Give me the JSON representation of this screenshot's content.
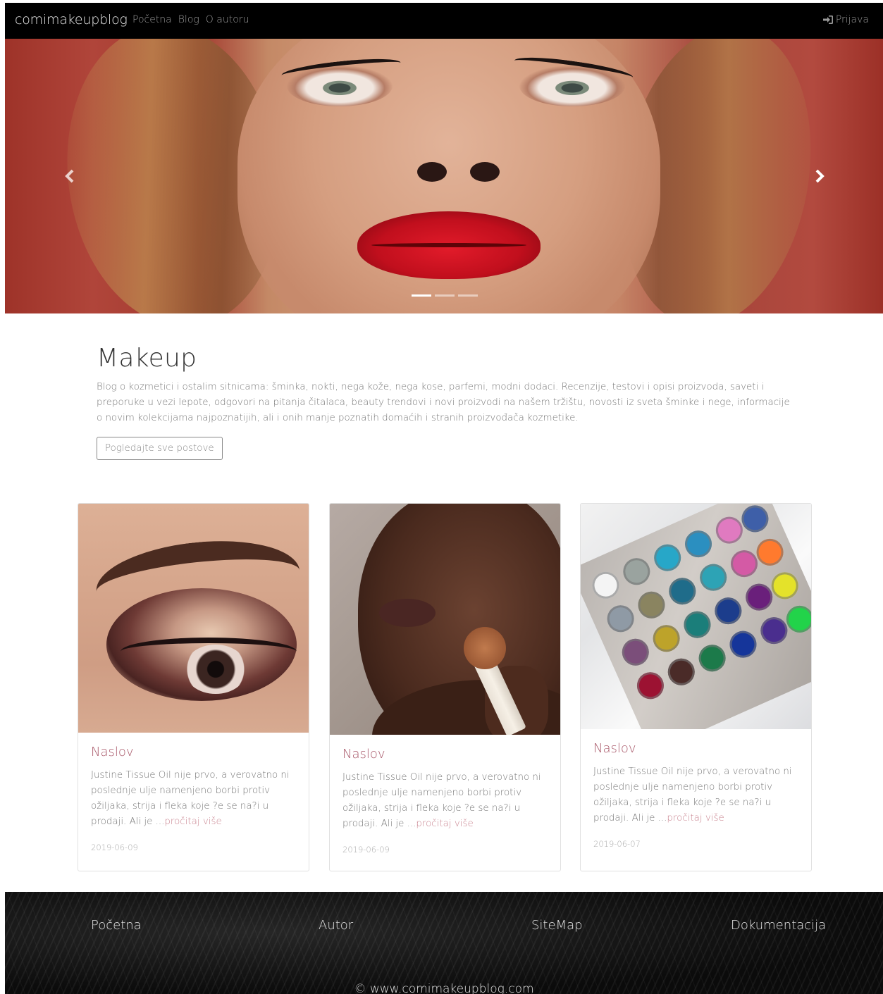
{
  "navbar": {
    "brand": "comimakeupblog",
    "links": [
      "Početna",
      "Blog",
      "O autoru"
    ],
    "login_label": "Prijava"
  },
  "carousel": {
    "slide_count": 3,
    "active_index": 0
  },
  "intro": {
    "title": "Makeup",
    "description": "Blog o kozmetici i ostalim sitnicama: šminka, nokti, nega kože, nega kose, parfemi, modni dodaci. Recenzije, testovi i opisi proizvoda, saveti i preporuke u vezi lepote, odgovori na pitanja čitalaca, beauty trendovi i novi proizvodi na našem tržištu, novosti iz sveta šminke i nege, informacije o novim kolekcijama najpoznatijih, ali i onih manje poznatih domaćih i stranih proizvođača kozmetike.",
    "button_label": "Pogledajte sve postove"
  },
  "cards": [
    {
      "title": "Naslov",
      "excerpt": "Justine Tissue Oil nije prvo, a verovatno ni poslednje ulje namenjeno borbi protiv ožiljaka, strija i fleka koje ?e se na?i u prodaji. Ali je ...",
      "more_label": "pročitaj više",
      "date": "2019-06-09"
    },
    {
      "title": "Naslov",
      "excerpt": "Justine Tissue Oil nije prvo, a verovatno ni poslednje ulje namenjeno borbi protiv ožiljaka, strija i fleka koje ?e se na?i u prodaji. Ali je ...",
      "more_label": "pročitaj više",
      "date": "2019-06-09"
    },
    {
      "title": "Naslov",
      "excerpt": "Justine Tissue Oil nije prvo, a verovatno ni poslednje ulje namenjeno borbi protiv ožiljaka, strija i fleka koje ?e se na?i u prodaji. Ali je ...",
      "more_label": "pročitaj više",
      "date": "2019-06-07"
    }
  ],
  "footer": {
    "links": [
      "Početna",
      "Autor",
      "SiteMap",
      "Dokumentacija"
    ],
    "copyright": "© www.comimakeupblog.com"
  },
  "colors": {
    "navbar_bg": "#000000",
    "card_title": "#a9596a",
    "read_more": "#c9838f"
  }
}
